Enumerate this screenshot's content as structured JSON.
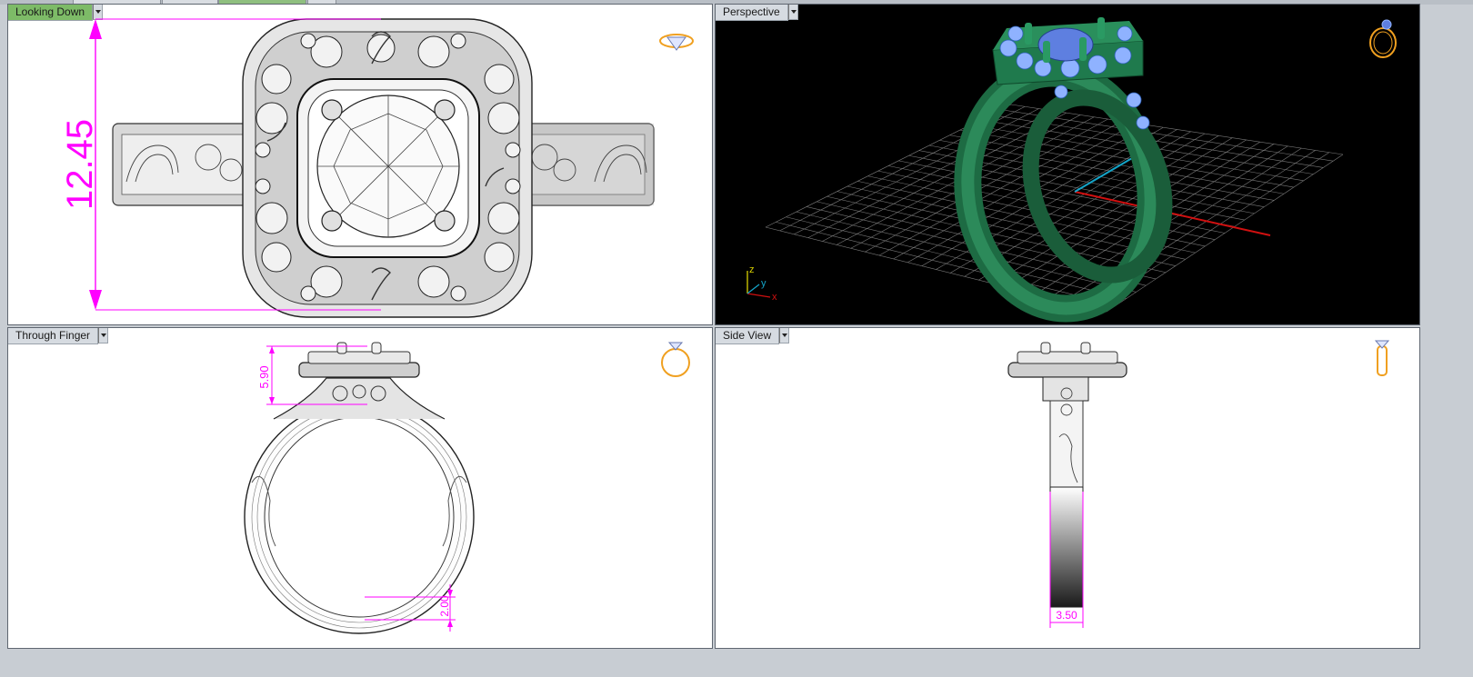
{
  "viewports": {
    "top_left": {
      "label": "Looking Down",
      "dimension": "12.45",
      "icon": "ring-top-view-icon"
    },
    "top_right": {
      "label": "Perspective",
      "axes": {
        "x": "x",
        "y": "y",
        "z": "z"
      },
      "icon": "ring-perspective-icon",
      "grid": true
    },
    "bottom_left": {
      "label": "Through Finger",
      "dimensions": {
        "head_height": "5.90",
        "shank_thickness": "2.00"
      },
      "icon": "ring-front-view-icon"
    },
    "bottom_right": {
      "label": "Side View",
      "dimension": "3.50",
      "icon": "ring-side-view-icon"
    }
  },
  "colors": {
    "active_label": "#7dbb67",
    "dimension": "#ff00ff",
    "ring_metal_render": "#1f7a4d",
    "gem_render": "#6f8fe6",
    "icon_accent": "#f0a020"
  }
}
